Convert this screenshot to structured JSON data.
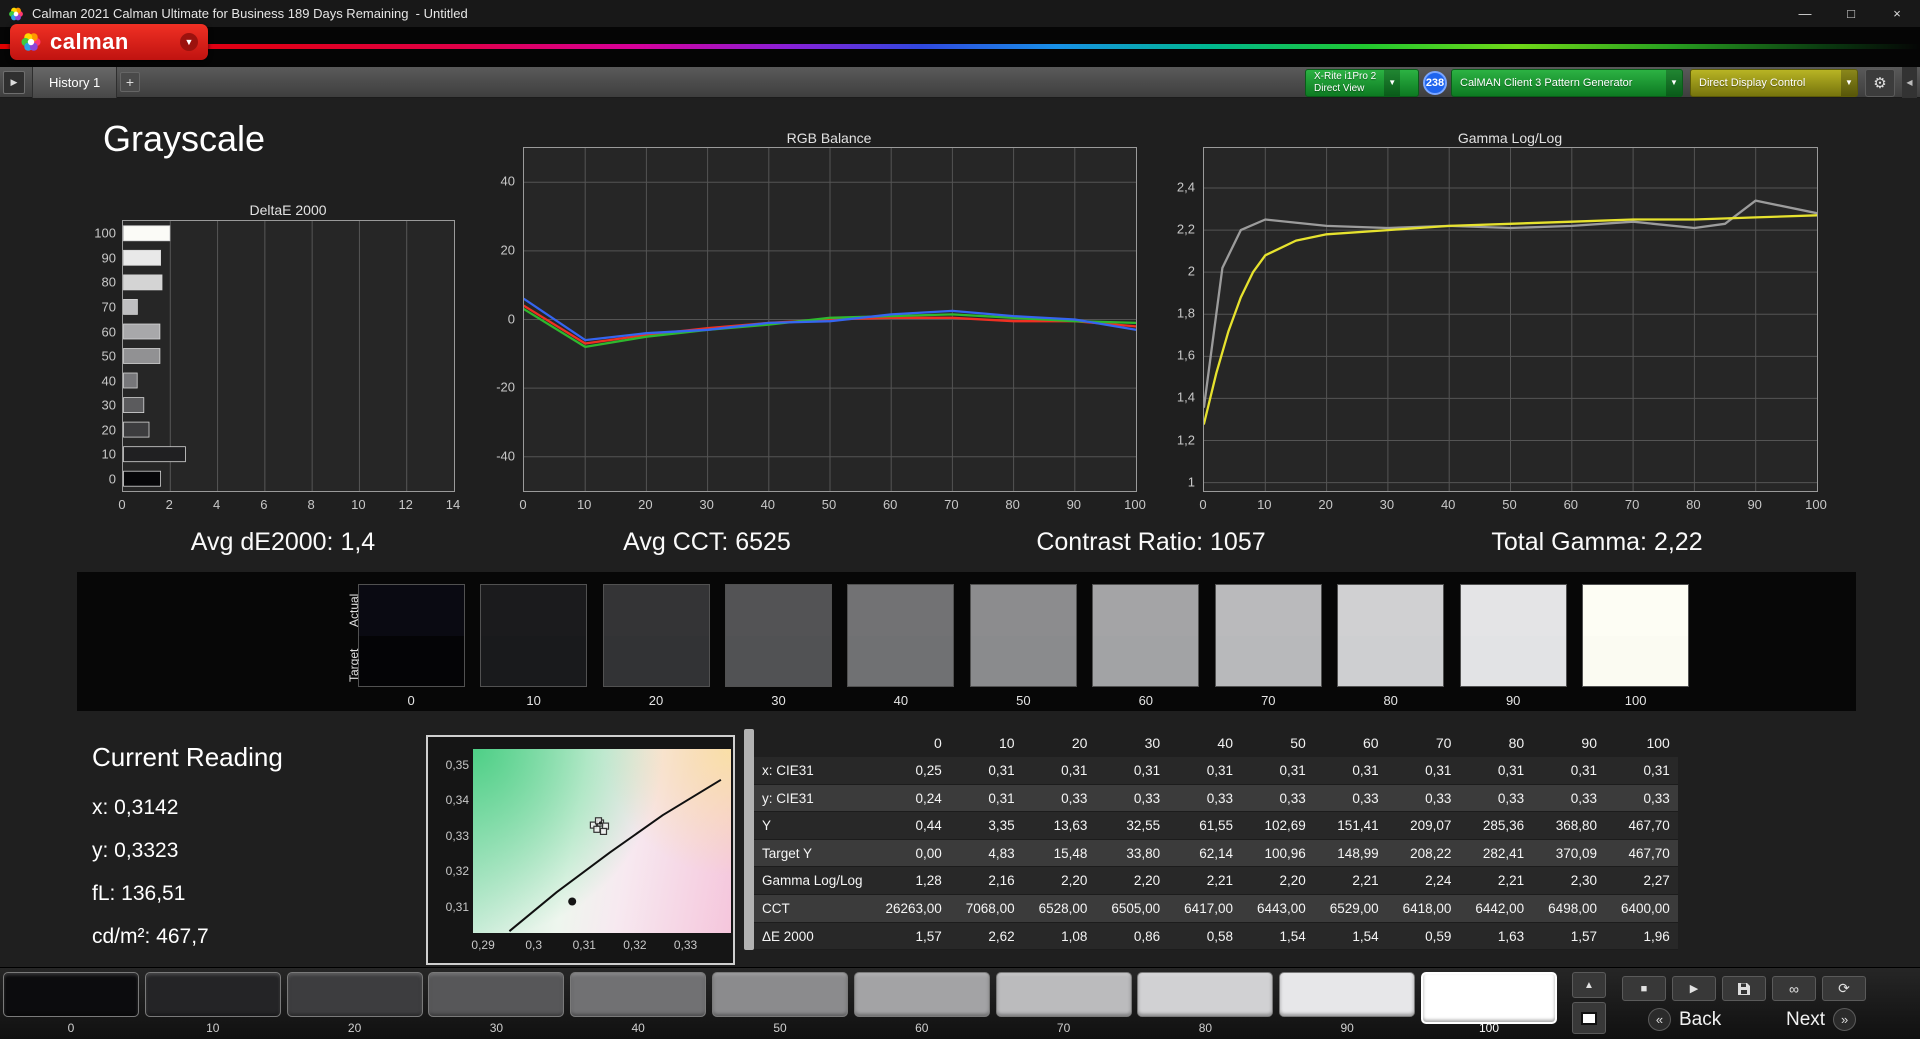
{
  "window": {
    "title": "Calman 2021 Calman Ultimate for Business 189 Days Remaining  - Untitled",
    "minimize": "—",
    "maximize": "□",
    "close": "×"
  },
  "brand": {
    "logo_text": "calman",
    "chevron": "▼"
  },
  "tab_bar": {
    "expander": "▶",
    "history_tab": "History 1",
    "add_tab": "+",
    "collapse_arrow": "◀"
  },
  "toolbar": {
    "meter_button": {
      "line1": "X-Rite i1Pro 2",
      "line2": "Direct View",
      "chevron": "▼"
    },
    "reading_badge": "238",
    "pattern_button": {
      "label": "CalMAN Client 3 Pattern Generator",
      "chevron": "▼"
    },
    "display_button": {
      "label": "Direct Display Control",
      "chevron": "▼"
    },
    "settings_icon": "⚙"
  },
  "page_title": "Grayscale",
  "summary": [
    "Avg dE2000: 1,4",
    "Avg CCT: 6525",
    "Contrast Ratio: 1057",
    "Total Gamma: 2,22"
  ],
  "current_reading": {
    "title": "Current Reading",
    "lines": [
      "x: 0,3142",
      "y: 0,3323",
      "fL: 136,51",
      "cd/m²: 467,7"
    ]
  },
  "swatch_strip": {
    "actual_label": "Actual",
    "target_label": "Target",
    "levels": [
      {
        "label": "0",
        "actual": "#0a0a12",
        "target": "#040406"
      },
      {
        "label": "10",
        "actual": "#1b1b1d",
        "target": "#191a1c"
      },
      {
        "label": "20",
        "actual": "#343436",
        "target": "#323335"
      },
      {
        "label": "30",
        "actual": "#535355",
        "target": "#515254"
      },
      {
        "label": "40",
        "actual": "#727274",
        "target": "#707173"
      },
      {
        "label": "50",
        "actual": "#8c8c8e",
        "target": "#8a8b8d"
      },
      {
        "label": "60",
        "actual": "#a4a4a6",
        "target": "#a2a3a5"
      },
      {
        "label": "70",
        "actual": "#bababc",
        "target": "#b8b9bb"
      },
      {
        "label": "80",
        "actual": "#d0d0d2",
        "target": "#cecfd1"
      },
      {
        "label": "90",
        "actual": "#e4e4e6",
        "target": "#e2e3e5"
      },
      {
        "label": "100",
        "actual": "#fdfdf4",
        "target": "#fbfbf2"
      }
    ]
  },
  "chart_data": [
    {
      "type": "bar",
      "title": "DeltaE 2000",
      "orientation": "horizontal",
      "categories": [
        "100",
        "90",
        "80",
        "70",
        "60",
        "50",
        "40",
        "30",
        "20",
        "10",
        "0"
      ],
      "values": [
        1.96,
        1.57,
        1.63,
        0.59,
        1.54,
        1.54,
        0.58,
        0.86,
        1.08,
        2.62,
        1.57
      ],
      "xlim": [
        0,
        14
      ],
      "xticks": [
        0,
        2,
        4,
        6,
        8,
        10,
        12,
        14
      ],
      "bar_colors": [
        "#fbfbf7",
        "#e9e9e9",
        "#d4d4d4",
        "#bfbfc1",
        "#a8a8aa",
        "#919193",
        "#77777a",
        "#5b5b5d",
        "#3d3d3f",
        "#202022",
        "#070709"
      ]
    },
    {
      "type": "line",
      "title": "RGB Balance",
      "xlim": [
        0,
        100
      ],
      "x": [
        0,
        10,
        20,
        30,
        40,
        50,
        60,
        70,
        80,
        90,
        100
      ],
      "xticks": [
        0,
        10,
        20,
        30,
        40,
        50,
        60,
        70,
        80,
        90,
        100
      ],
      "ylim": [
        -50,
        50
      ],
      "yticks": [
        {
          "v": 40,
          "label": "40"
        },
        {
          "v": 20,
          "label": "20"
        },
        {
          "v": 0,
          "label": "0"
        },
        {
          "v": -20,
          "label": "-20"
        },
        {
          "v": -40,
          "label": "-40"
        }
      ],
      "series": [
        {
          "name": "red",
          "color": "#f03022",
          "values": [
            4,
            -7,
            -4.5,
            -2.5,
            -1,
            0,
            0.5,
            0.5,
            -0.5,
            -0.5,
            -2
          ]
        },
        {
          "name": "green",
          "color": "#2eb82e",
          "values": [
            3,
            -8,
            -5,
            -3,
            -1.5,
            0.5,
            1,
            1.5,
            0.5,
            -0.5,
            -1
          ]
        },
        {
          "name": "blue",
          "color": "#3565f0",
          "values": [
            6,
            -6,
            -4,
            -3,
            -1,
            -0.5,
            1.5,
            2.5,
            1,
            0,
            -3
          ]
        }
      ]
    },
    {
      "type": "line",
      "title": "Gamma Log/Log",
      "xlim": [
        0,
        100
      ],
      "xticks": [
        0,
        10,
        20,
        30,
        40,
        50,
        60,
        70,
        80,
        90,
        100
      ],
      "ylim": [
        0.96,
        2.59
      ],
      "yticks": [
        {
          "v": 2.4,
          "label": "2,4"
        },
        {
          "v": 2.2,
          "label": "2,2"
        },
        {
          "v": 2.0,
          "label": "2"
        },
        {
          "v": 1.8,
          "label": "1,8"
        },
        {
          "v": 1.6,
          "label": "1,6"
        },
        {
          "v": 1.4,
          "label": "1,4"
        },
        {
          "v": 1.2,
          "label": "1,2"
        },
        {
          "v": 1.0,
          "label": "1"
        }
      ],
      "series": [
        {
          "name": "reference",
          "color": "#9c9c9c",
          "x": [
            0,
            3,
            6,
            10,
            20,
            30,
            40,
            50,
            60,
            70,
            80,
            85,
            90,
            100
          ],
          "values": [
            1.36,
            2.02,
            2.2,
            2.25,
            2.22,
            2.21,
            2.22,
            2.21,
            2.22,
            2.24,
            2.21,
            2.23,
            2.34,
            2.28
          ]
        },
        {
          "name": "measured",
          "color": "#e6e22e",
          "x": [
            0,
            2,
            4,
            6,
            8,
            10,
            15,
            20,
            30,
            40,
            50,
            60,
            70,
            80,
            90,
            100
          ],
          "values": [
            1.28,
            1.52,
            1.72,
            1.88,
            2.0,
            2.08,
            2.15,
            2.18,
            2.2,
            2.22,
            2.23,
            2.24,
            2.25,
            2.25,
            2.26,
            2.27
          ]
        }
      ]
    },
    {
      "type": "scatter",
      "xlim": [
        0.288,
        0.339
      ],
      "ylim": [
        0.3025,
        0.3545
      ],
      "xticks": [
        {
          "v": 0.29,
          "label": "0,29"
        },
        {
          "v": 0.3,
          "label": "0,3"
        },
        {
          "v": 0.31,
          "label": "0,31"
        },
        {
          "v": 0.32,
          "label": "0,32"
        },
        {
          "v": 0.33,
          "label": "0,33"
        }
      ],
      "yticks": [
        {
          "v": 0.35,
          "label": "0,35"
        },
        {
          "v": 0.34,
          "label": "0,34"
        },
        {
          "v": 0.33,
          "label": "0,33"
        },
        {
          "v": 0.32,
          "label": "0,32"
        },
        {
          "v": 0.31,
          "label": "0,31"
        }
      ],
      "locus": [
        [
          0.2952,
          0.303
        ],
        [
          0.3045,
          0.314
        ],
        [
          0.315,
          0.3252
        ],
        [
          0.3255,
          0.3358
        ],
        [
          0.337,
          0.3458
        ]
      ],
      "points": [
        {
          "x": 0.3118,
          "y": 0.333
        },
        {
          "x": 0.3132,
          "y": 0.3336
        },
        {
          "x": 0.3142,
          "y": 0.3327
        },
        {
          "x": 0.3125,
          "y": 0.3318
        },
        {
          "x": 0.3138,
          "y": 0.3312
        },
        {
          "x": 0.3128,
          "y": 0.3342
        }
      ],
      "marker": {
        "x": 0.3076,
        "y": 0.3114
      }
    }
  ],
  "table": {
    "header": [
      "",
      "0",
      "10",
      "20",
      "30",
      "40",
      "50",
      "60",
      "70",
      "80",
      "90",
      "100"
    ],
    "rows": [
      {
        "label": "x: CIE31",
        "values": [
          "0,25",
          "0,31",
          "0,31",
          "0,31",
          "0,31",
          "0,31",
          "0,31",
          "0,31",
          "0,31",
          "0,31",
          "0,31"
        ]
      },
      {
        "label": "y: CIE31",
        "values": [
          "0,24",
          "0,31",
          "0,33",
          "0,33",
          "0,33",
          "0,33",
          "0,33",
          "0,33",
          "0,33",
          "0,33",
          "0,33"
        ]
      },
      {
        "label": "Y",
        "values": [
          "0,44",
          "3,35",
          "13,63",
          "32,55",
          "61,55",
          "102,69",
          "151,41",
          "209,07",
          "285,36",
          "368,80",
          "467,70"
        ]
      },
      {
        "label": "Target Y",
        "values": [
          "0,00",
          "4,83",
          "15,48",
          "33,80",
          "62,14",
          "100,96",
          "148,99",
          "208,22",
          "282,41",
          "370,09",
          "467,70"
        ]
      },
      {
        "label": "Gamma Log/Log",
        "values": [
          "1,28",
          "2,16",
          "2,20",
          "2,20",
          "2,21",
          "2,20",
          "2,21",
          "2,24",
          "2,21",
          "2,30",
          "2,27"
        ]
      },
      {
        "label": "CCT",
        "values": [
          "26263,00",
          "7068,00",
          "6528,00",
          "6505,00",
          "6417,00",
          "6443,00",
          "6529,00",
          "6418,00",
          "6442,00",
          "6498,00",
          "6400,00"
        ]
      },
      {
        "label": "ΔE 2000",
        "values": [
          "1,57",
          "2,62",
          "1,08",
          "0,86",
          "0,58",
          "1,54",
          "1,54",
          "0,59",
          "1,63",
          "1,57",
          "1,96"
        ]
      }
    ]
  },
  "bottom_bar": {
    "selected": "100",
    "patches": [
      {
        "label": "0",
        "color": "#0c0c0e"
      },
      {
        "label": "10",
        "color": "#242426"
      },
      {
        "label": "20",
        "color": "#3d3d3f"
      },
      {
        "label": "30",
        "color": "#575759"
      },
      {
        "label": "40",
        "color": "#717173"
      },
      {
        "label": "50",
        "color": "#8b8b8d"
      },
      {
        "label": "60",
        "color": "#a3a3a5"
      },
      {
        "label": "70",
        "color": "#bbbbbd"
      },
      {
        "label": "80",
        "color": "#d1d1d3"
      },
      {
        "label": "90",
        "color": "#e7e7e9"
      },
      {
        "label": "100",
        "color": "#ffffff"
      }
    ],
    "controls": {
      "up": "▲",
      "stop": "■",
      "play": "▶",
      "loop": "∞",
      "refresh": "⟳",
      "back": "Back",
      "next": "Next",
      "back_chevron": "«",
      "next_chevron": "»"
    }
  }
}
